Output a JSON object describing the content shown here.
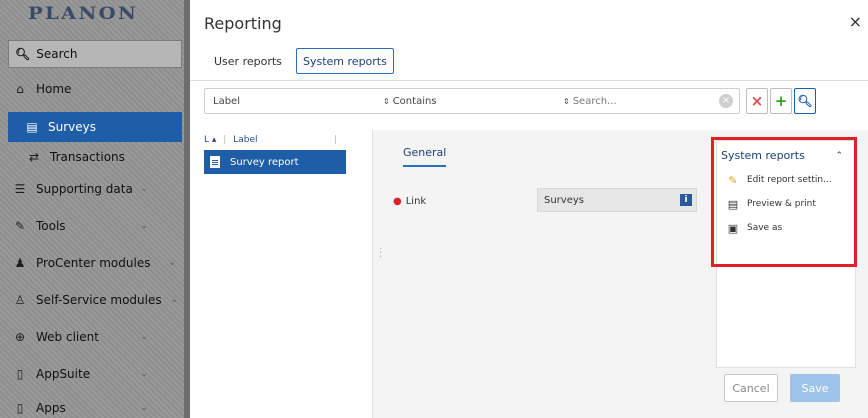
{
  "sidebar": {
    "logo": "PLANON",
    "search_label": "Search",
    "items": [
      {
        "label": "Home",
        "icon": "home-icon"
      },
      {
        "label": "Surveys",
        "icon": "clipboard-icon"
      },
      {
        "label": "Transactions",
        "icon": "transfer-icon"
      },
      {
        "label": "Supporting data",
        "icon": "database-icon"
      },
      {
        "label": "Tools",
        "icon": "wrench-icon"
      },
      {
        "label": "ProCenter modules",
        "icon": "user-group-icon"
      },
      {
        "label": "Self-Service modules",
        "icon": "person-icon"
      },
      {
        "label": "Web client",
        "icon": "globe-icon"
      },
      {
        "label": "AppSuite",
        "icon": "tablet-icon"
      },
      {
        "label": "Apps",
        "icon": "tablet-icon"
      }
    ]
  },
  "dialog": {
    "title": "Reporting",
    "close_symbol": "×",
    "tabs": [
      {
        "label": "User reports"
      },
      {
        "label": "System reports"
      }
    ],
    "filter": {
      "field": "Label",
      "operator": "Contains",
      "placeholder": "Search..."
    },
    "list": {
      "sort_label": "L ▴",
      "column": "Label",
      "rows": [
        {
          "label": "Survey report"
        }
      ]
    },
    "detail": {
      "tab": "General",
      "field_label": "Link",
      "field_value": "Surveys",
      "info_symbol": "i"
    },
    "menu": {
      "title": "System reports",
      "items": [
        {
          "label": "Edit report settin...",
          "icon": "pencil-icon"
        },
        {
          "label": "Preview & print",
          "icon": "document-icon"
        },
        {
          "label": "Save as",
          "icon": "floppy-disk-icon"
        }
      ]
    },
    "buttons": {
      "cancel": "Cancel",
      "save": "Save"
    },
    "colors": {
      "accent": "#1e5ea8",
      "highlight_box": "#e21f26",
      "add_green": "#3a9a2a",
      "remove_red": "#e24a4a"
    }
  }
}
